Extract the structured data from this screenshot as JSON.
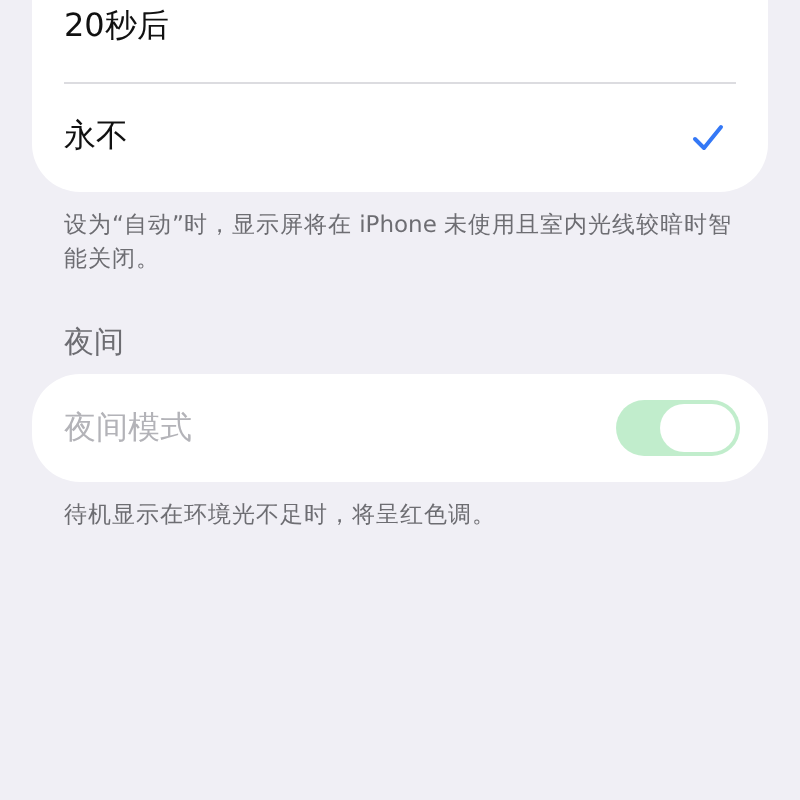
{
  "timeout_options": [
    {
      "label": "20秒后",
      "selected": false
    },
    {
      "label": "永不",
      "selected": true
    }
  ],
  "timeout_footer": "设为“自动”时，显示屏将在 iPhone 未使用且室内光线较暗时智能关闭。",
  "night_section": {
    "header": "夜间",
    "label": "夜间模式",
    "on": true,
    "disabled": true,
    "footer": "待机显示在环境光不足时，将呈红色调。"
  }
}
